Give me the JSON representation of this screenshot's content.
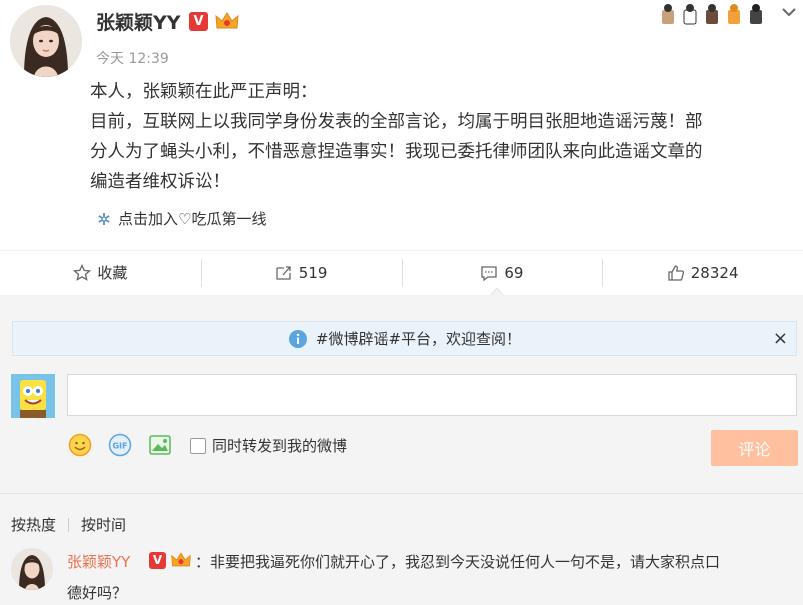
{
  "post": {
    "username": "张颖颖YY",
    "verified_badge": "V",
    "time": "今天 12:39",
    "lines": [
      "本人，张颖颖在此严正声明：",
      "目前，互联网上以我同学身份发表的全部言论，均属于明目张胆地造谣污蔑！部",
      "分人为了蝇头小利，不惜恶意捏造事实！我现已委托律师团队来向此造谣文章的",
      "编造者维权诉讼！"
    ],
    "topic_link": "点击加入♡吃瓜第一线"
  },
  "actions": {
    "favorite": "收藏",
    "repost": "519",
    "comment": "69",
    "like": "28324"
  },
  "notice": {
    "text": "#微博辟谣#平台，欢迎查阅！",
    "close": "×"
  },
  "composer": {
    "input_value": "",
    "repost_checkbox": "同时转发到我的微博",
    "submit": "评论"
  },
  "sort": {
    "hot": "按热度",
    "time": "按时间"
  },
  "comment": {
    "username": "张颖颖YY",
    "verified_badge": "V",
    "text_line1": "：非要把我逼死你们就开心了，我忍到今天没说任何人一句不是，请大家积点口",
    "text_line2": "德好吗？"
  },
  "colors": {
    "accent_orange": "#eb7350",
    "submit_disabled": "#ffc09f",
    "verified_red": "#e53935",
    "notice_bg": "#eaf3fa"
  }
}
